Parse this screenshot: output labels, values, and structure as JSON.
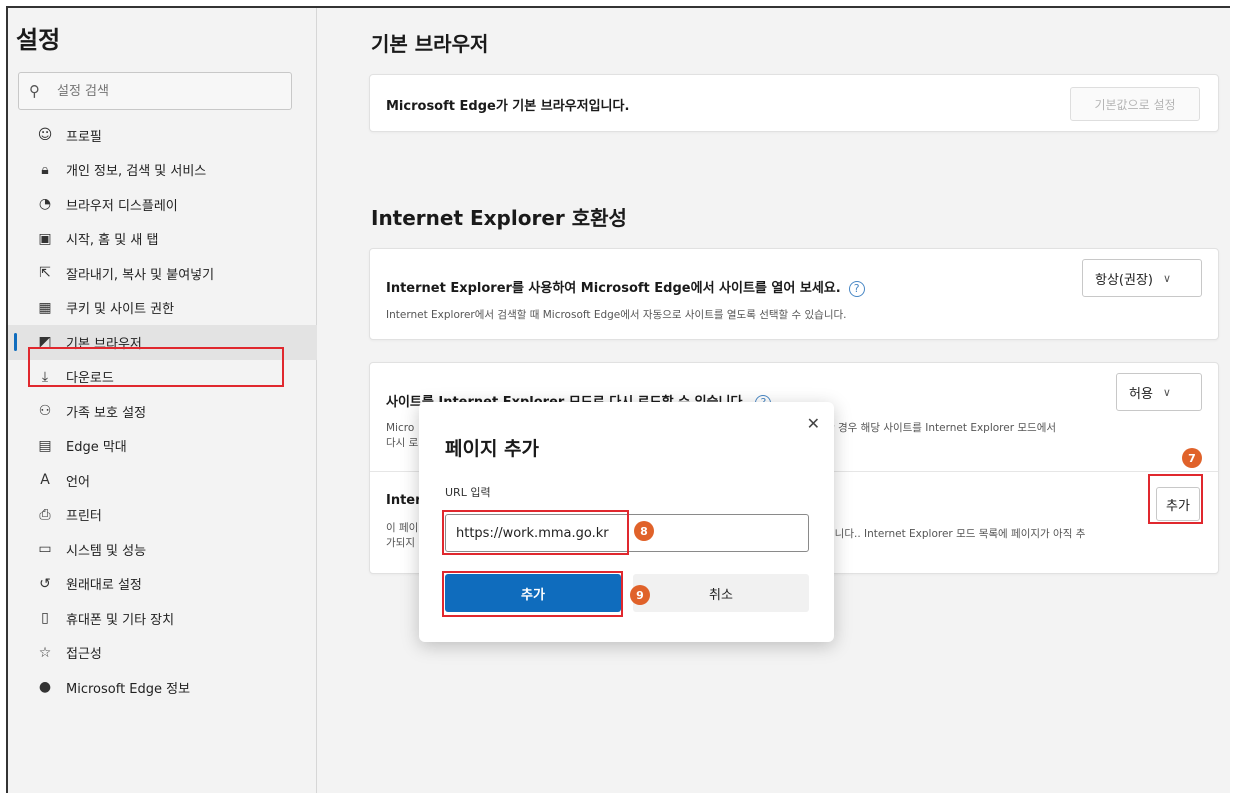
{
  "sidebar": {
    "title": "설정",
    "search_placeholder": "설정 검색",
    "items": [
      {
        "label": "프로필",
        "icon": "profile-icon",
        "glyph": "☺"
      },
      {
        "label": "개인 정보, 검색 및 서비스",
        "icon": "lock-icon",
        "glyph": "🔒︎"
      },
      {
        "label": "브라우저 디스플레이",
        "icon": "palette-icon",
        "glyph": "◔"
      },
      {
        "label": "시작, 홈 및 새 탭",
        "icon": "home-icon",
        "glyph": "▣"
      },
      {
        "label": "잘라내기, 복사 및 붙여넣기",
        "icon": "share-icon",
        "glyph": "⇱"
      },
      {
        "label": "쿠키 및 사이트 권한",
        "icon": "cookie-icon",
        "glyph": "▦"
      },
      {
        "label": "기본 브라우저",
        "icon": "browser-icon",
        "glyph": "◩",
        "active": true
      },
      {
        "label": "다운로드",
        "icon": "download-icon",
        "glyph": "⤓"
      },
      {
        "label": "가족 보호 설정",
        "icon": "family-icon",
        "glyph": "⚇"
      },
      {
        "label": "Edge 막대",
        "icon": "edge-bar-icon",
        "glyph": "▤"
      },
      {
        "label": "언어",
        "icon": "language-icon",
        "glyph": "A"
      },
      {
        "label": "프린터",
        "icon": "printer-icon",
        "glyph": "⎙"
      },
      {
        "label": "시스템 및 성능",
        "icon": "system-icon",
        "glyph": "▭"
      },
      {
        "label": "원래대로 설정",
        "icon": "reset-icon",
        "glyph": "↺"
      },
      {
        "label": "휴대폰 및 기타 장치",
        "icon": "phone-icon",
        "glyph": "▯"
      },
      {
        "label": "접근성",
        "icon": "accessibility-icon",
        "glyph": "☆"
      },
      {
        "label": "Microsoft Edge 정보",
        "icon": "edge-logo-icon",
        "glyph": "●"
      }
    ]
  },
  "main": {
    "default_browser_heading": "기본 브라우저",
    "default_browser_text": "Microsoft Edge가 기본 브라우저입니다.",
    "set_default_button": "기본값으로 설정",
    "ie_heading": "Internet Explorer 호환성",
    "ie_open_title": "Internet Explorer를 사용하여 Microsoft Edge에서 사이트를 열어 보세요.",
    "ie_open_desc": "Internet Explorer에서 검색할 때 Microsoft Edge에서 자동으로 사이트를 열도록 선택할 수 있습니다.",
    "ie_open_select": "항상(권장)",
    "ie_reload_title": "사이트를 Internet Explorer 모드로 다시 로드할 수 있습니다.",
    "ie_reload_desc_left": "Micro",
    "ie_reload_desc_left2": "다시 로",
    "ie_reload_desc_right": "한 경우 해당 사이트를 Internet Explorer 모드에서",
    "ie_reload_select": "허용",
    "ie_pages_title": "Inter",
    "ie_pages_desc_left": "이 페이",
    "ie_pages_desc_left2": "가되지",
    "ie_pages_desc_right": "됩니다.. Internet Explorer 모드 목록에 페이지가 아직 추",
    "add_button": "추가",
    "help_glyph": "?"
  },
  "modal": {
    "title": "페이지 추가",
    "close_glyph": "✕",
    "url_label": "URL 입력",
    "url_value": "https://work.mma.go.kr",
    "add_label": "추가",
    "cancel_label": "취소"
  },
  "annotations": {
    "badge7": "7",
    "badge8": "8",
    "badge9": "9"
  },
  "colors": {
    "accent": "#0f6cbd",
    "highlight": "#e0282e",
    "badge": "#e0622a"
  }
}
